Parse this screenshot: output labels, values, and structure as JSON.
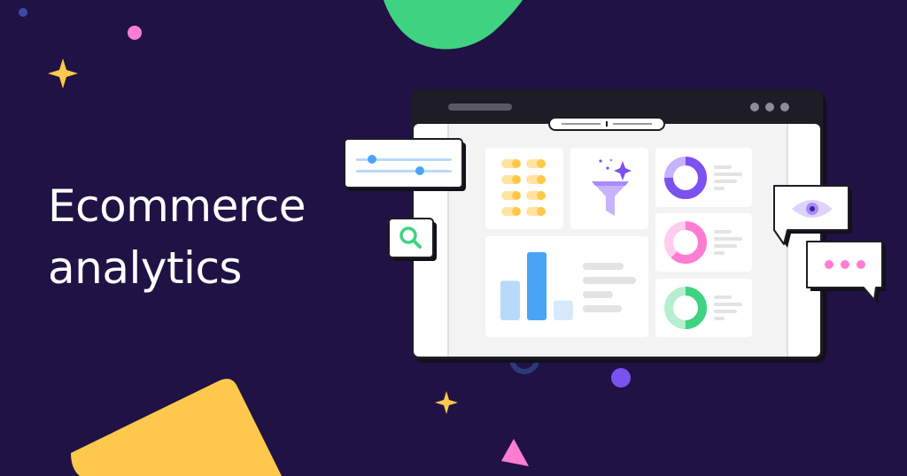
{
  "headline": {
    "line1": "Ecommerce",
    "line2": "analytics"
  },
  "colors": {
    "background": "#201244",
    "window_frame": "#1e1c24",
    "window_body": "#f3f3f3",
    "card": "#ffffff",
    "green": "#3fd280",
    "yellow": "#fdc84b",
    "pink": "#ff7cd3",
    "purple": "#7b52f0",
    "blue": "#4aa4f5",
    "light_blue": "#b8dafa"
  },
  "icons": [
    "slider-icon",
    "search-icon",
    "filter-funnel-icon",
    "sparkle-icon",
    "eye-icon",
    "chat-bubble-icon",
    "donut-chart-icon",
    "bar-chart-icon"
  ],
  "dashboard": {
    "donuts": [
      {
        "color": "purple",
        "fraction": 0.75
      },
      {
        "color": "pink",
        "fraction": 0.62
      },
      {
        "color": "green",
        "fraction": 0.5
      }
    ],
    "bars": [
      {
        "color": "light_blue",
        "value": 0.58
      },
      {
        "color": "blue",
        "value": 1.0
      },
      {
        "color": "pale_blue",
        "value": 0.29
      }
    ]
  }
}
